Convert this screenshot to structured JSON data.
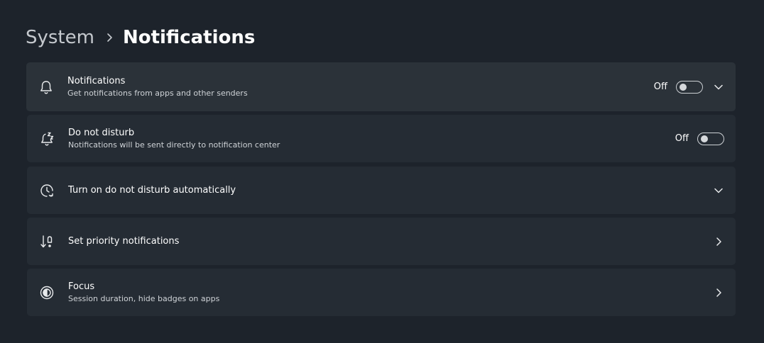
{
  "breadcrumb": {
    "parent": "System",
    "current": "Notifications"
  },
  "settings": [
    {
      "title": "Notifications",
      "subtitle": "Get notifications from apps and other senders",
      "icon": "bell-icon",
      "toggle_state": "Off",
      "has_toggle": true,
      "expander": "chevron-down"
    },
    {
      "title": "Do not disturb",
      "subtitle": "Notifications will be sent directly to notification center",
      "icon": "bell-snooze-icon",
      "toggle_state": "Off",
      "has_toggle": true
    },
    {
      "title": "Turn on do not disturb automatically",
      "icon": "clock-refresh-icon",
      "expander": "chevron-down"
    },
    {
      "title": "Set priority notifications",
      "icon": "priority-sort-icon",
      "expander": "chevron-right"
    },
    {
      "title": "Focus",
      "subtitle": "Session duration, hide badges on apps",
      "icon": "focus-icon",
      "expander": "chevron-right"
    }
  ],
  "colors": {
    "background": "#1d232b",
    "card": "#252c34",
    "card_hover": "#2b3239",
    "text": "#ffffff",
    "subtext": "#cfd3d7"
  }
}
